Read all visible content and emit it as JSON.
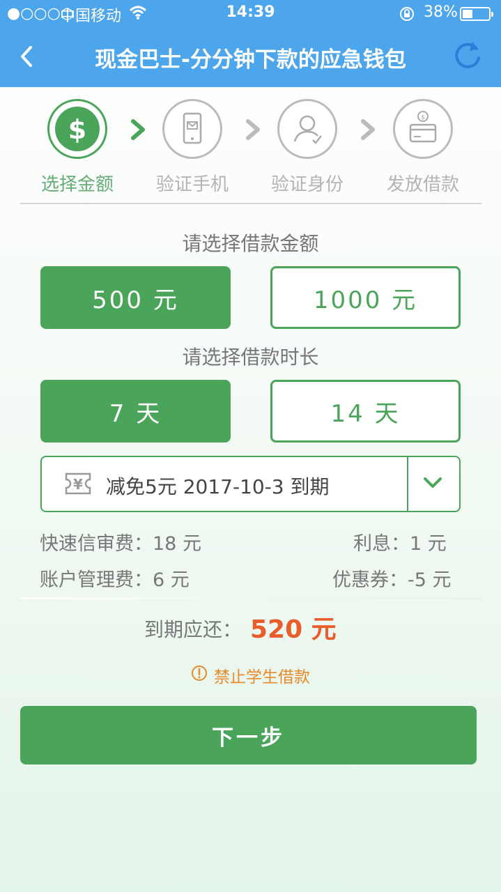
{
  "status_bar": {
    "signal": "●○○○○",
    "carrier": "中国移动",
    "time": "14:39",
    "battery_pct": "38%",
    "battery_level": 0.38
  },
  "header": {
    "title": "现金巴士-分分钟下款的应急钱包",
    "back_icon": "chevron-left-icon",
    "refresh_icon": "refresh-icon"
  },
  "steps": [
    {
      "label": "选择金额",
      "icon": "dollar-icon",
      "active": true
    },
    {
      "label": "验证手机",
      "icon": "phone-icon",
      "active": false
    },
    {
      "label": "验证身份",
      "icon": "user-check-icon",
      "active": false
    },
    {
      "label": "发放借款",
      "icon": "card-icon",
      "active": false
    }
  ],
  "amount": {
    "title": "请选择借款金额",
    "options": [
      "500 元",
      "1000 元"
    ],
    "selected": 0
  },
  "duration": {
    "title": "请选择借款时长",
    "options": [
      "7 天",
      "14 天"
    ],
    "selected": 0
  },
  "coupon": {
    "icon": "yen-ticket-icon",
    "text": "减免5元 2017-10-3 到期",
    "dropdown_icon": "chevron-down-icon"
  },
  "fees": {
    "review_fee": "快速信审费：18 元",
    "interest": "利息：1 元",
    "management_fee": "账户管理费：6 元",
    "coupon_discount": "优惠券：-5 元"
  },
  "due": {
    "label": "到期应还：",
    "amount": "520 元"
  },
  "warning": {
    "icon": "exclamation-circle-icon",
    "text": "禁止学生借款"
  },
  "next_button": "下一步",
  "colors": {
    "header": "#4da6ec",
    "accent_green": "#4aa55a",
    "due_orange": "#e85d2a",
    "warning_orange": "#e8892a"
  }
}
